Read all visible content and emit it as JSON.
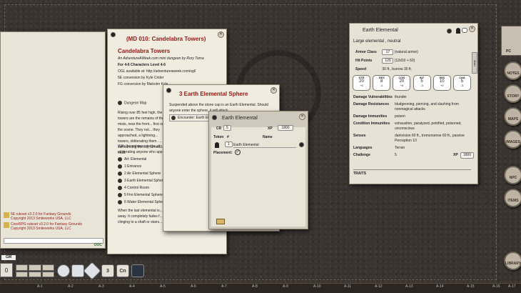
{
  "chat": {
    "entries": [
      {
        "text": "5E ruleset v3.2.0 for Fantasy Grounds"
      },
      {
        "text": "Copyright 2013 Smiteworks USA, LLC"
      },
      {
        "text": "CoreRPG ruleset v3.2.0 for Fantasy Grounds"
      },
      {
        "text": "Copyright 2013 Smiteworks USA, LLC"
      }
    ],
    "ooc": "OOC",
    "gm_label": "GM",
    "dice_modifier": "0"
  },
  "story": {
    "title": "(MD 010: Candelabra Towers)",
    "heading": "Candelabra Towers",
    "lines": [
      "An AdventureAWeek.com mini dungeon by Rory Toma",
      "For 4-6 Characters Level 4-6",
      "OGL available at: http://adventureaweek.com/ogl/",
      "5E conversion by Kyle Crider",
      "FG conversion by Malcolm Kyle"
    ],
    "dungeon_map": "Dungeon Map",
    "body1": "Rising over 85 feet high, the towers are the remains of the mists, near the front... first on the scene. They not... they approached, a lightning... towers, obliterating them. ... surrounding the city turned... mud.",
    "body2": "With the entrance to the city... obliterating anyone who app...",
    "areas": [
      "Art: Elemental",
      "1 Entrance",
      "2 Air Elemental Sphere",
      "3 Earth Elemental Sphere",
      "4 Control Room",
      "5 Fire Elemental Sphere",
      "6 Water Elemental Sphere"
    ],
    "body3": "When the last elemental is... away. It completely fades f... is clinging to a shaft or stairs..."
  },
  "sphere": {
    "title": "3 Earth Elemental Sphere",
    "text": "Suspended above the stone cap is an Earth Elemental. Should anyone enter the sphere, it will attack.",
    "encounter": "Encounter: Earth El..."
  },
  "encounter": {
    "title": "Earth Elemental",
    "cr_label": "CR",
    "cr": "5",
    "xp_label": "XP",
    "xp": "1800",
    "col_token": "Token",
    "col_num": "#",
    "col_name": "Name",
    "row_num": "1",
    "row_name": "Earth Elemental",
    "placement_label": "Placement:"
  },
  "npc": {
    "title": "Earth Elemental",
    "type": "Large elemental , neutral",
    "ac_label": "Armor Class",
    "ac": "17",
    "ac_note": "(natural armor)",
    "hp_label": "Hit Points",
    "hp": "126",
    "hp_note": "(12d10 + 60)",
    "speed_label": "Speed",
    "speed": "30 ft., burrow 30 ft.",
    "abilities": [
      {
        "name": "STR",
        "score": "20",
        "mod": "+5"
      },
      {
        "name": "DEX",
        "score": "8",
        "mod": "-1"
      },
      {
        "name": "CON",
        "score": "20",
        "mod": "+5"
      },
      {
        "name": "INT",
        "score": "5",
        "mod": "-3"
      },
      {
        "name": "WIS",
        "score": "10",
        "mod": "+0"
      },
      {
        "name": "CHA",
        "score": "5",
        "mod": "-3"
      }
    ],
    "vuln_label": "Damage Vulnerabilities",
    "vuln": "thunder",
    "res_label": "Damage Resistances",
    "res": "bludgeoning, piercing, and slashing from nonmagical attacks",
    "imm_label": "Damage Immunities",
    "imm": "poison",
    "cond_label": "Condition Immunities",
    "cond": "exhaustion, paralyzed, petrified, poisoned, unconscious",
    "senses_label": "Senses",
    "senses": "darkvision 60 ft., tremorsense 60 ft., passive Perception 10",
    "lang_label": "Languages",
    "lang": "Terran",
    "chal_label": "Challenge",
    "chal": "5",
    "xp_label": "XP",
    "xp": "1800",
    "traits_label": "TRAITS",
    "tab_label": "Main"
  },
  "sidebar": {
    "items": [
      "PC",
      "NOTES",
      "STORY",
      "MAPS",
      "IMAGES",
      "NPC",
      "ITEMS",
      "LIBRARY"
    ]
  },
  "hotkeys": {
    "buttons": [
      "d4",
      "d6",
      "d8",
      "d10",
      "d12",
      "d20",
      "3",
      "Cn"
    ]
  },
  "grid": {
    "labels": [
      "A-1",
      "A-2",
      "A-3",
      "A-4",
      "A-5",
      "A-6",
      "A-7",
      "A-8",
      "A-9",
      "A-10",
      "A-11",
      "A-12",
      "A-13",
      "A-14",
      "A-15",
      "A-16",
      "A-17"
    ]
  },
  "colors": {
    "accent_red": "#8e1a14",
    "leather": "#3a3430",
    "parchment": "#ece7dc"
  }
}
